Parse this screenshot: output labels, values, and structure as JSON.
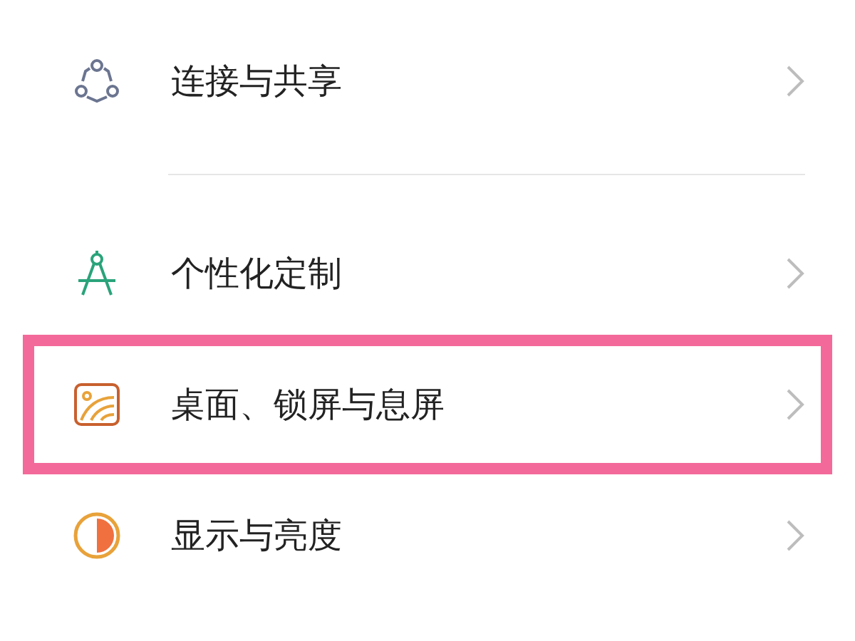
{
  "sections": [
    {
      "items": [
        {
          "label": "连接与共享",
          "kind": "share",
          "highlighted": false
        }
      ]
    },
    {
      "items": [
        {
          "label": "个性化定制",
          "kind": "compass",
          "highlighted": false
        },
        {
          "label": "桌面、锁屏与息屏",
          "kind": "wallpaper",
          "highlighted": true
        },
        {
          "label": "显示与亮度",
          "kind": "contrast",
          "highlighted": false
        }
      ]
    }
  ]
}
